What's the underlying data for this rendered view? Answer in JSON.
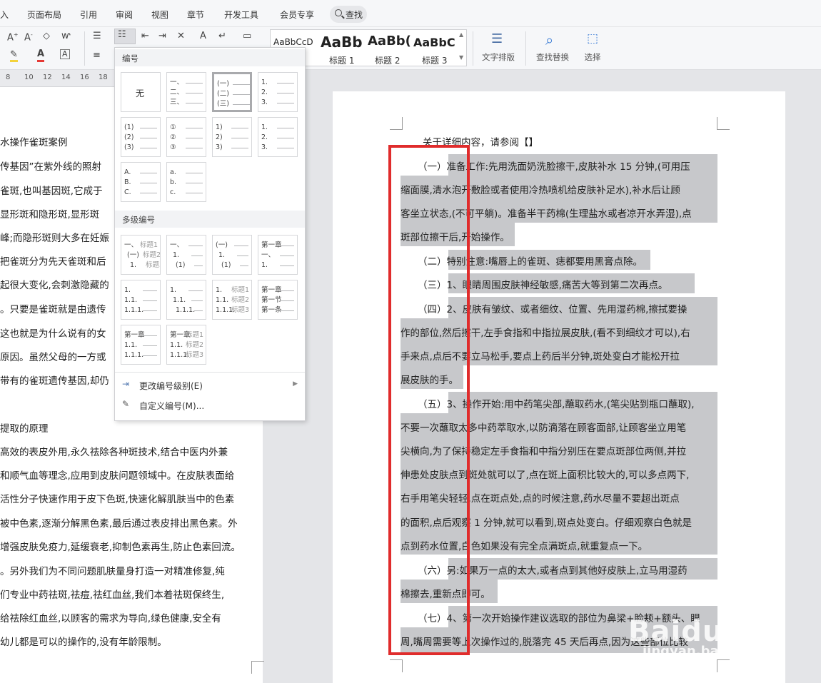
{
  "menu_tabs": [
    "入",
    "页面布局",
    "引用",
    "审阅",
    "视图",
    "章节",
    "开发工具",
    "会员专享"
  ],
  "search_tab": "查找",
  "ribbon": {
    "styles": [
      {
        "preview": "AaBbCcD",
        "name": ""
      },
      {
        "preview": "AaBb",
        "name": "标题 1"
      },
      {
        "preview": "AaBb(",
        "name": "标题 2"
      },
      {
        "preview": "AaBbC",
        "name": "标题 3"
      }
    ],
    "text_layout": "文字排版",
    "find_replace": "查找替换",
    "select": "选择"
  },
  "ruler": [
    "8",
    "10",
    "12",
    "14",
    "16",
    "18"
  ],
  "numbering_panel": {
    "section_numbering": "编号",
    "none_label": "无",
    "single": [
      [
        "一、",
        "二、",
        "三、"
      ],
      [
        "(一)",
        "(二)",
        "(三)"
      ],
      [
        "1.",
        "2.",
        "3."
      ],
      [
        "(1)",
        "(2)",
        "(3)"
      ],
      [
        "①",
        "②",
        "③"
      ],
      [
        "1)",
        "2)",
        "3)"
      ],
      [
        "1.",
        "2.",
        "3."
      ],
      [
        "A.",
        "B.",
        "C."
      ],
      [
        "a.",
        "b.",
        "c."
      ]
    ],
    "section_multilevel": "多级编号",
    "multi": [
      [
        [
          "一、",
          "标题1"
        ],
        [
          "(一)",
          "标题2"
        ],
        [
          "1.",
          "标题3"
        ]
      ],
      [
        [
          "一、",
          ""
        ],
        [
          "1.",
          ""
        ],
        [
          "(1)",
          ""
        ]
      ],
      [
        [
          "(一)",
          ""
        ],
        [
          "1.",
          ""
        ],
        [
          "(1)",
          ""
        ]
      ],
      [
        [
          "第一章",
          ""
        ],
        [
          "一、",
          ""
        ],
        [
          "1.",
          ""
        ]
      ],
      [
        [
          "1.",
          ""
        ],
        [
          "1.1.",
          ""
        ],
        [
          "1.1.1.",
          ""
        ]
      ],
      [
        [
          "1.",
          ""
        ],
        [
          "1.1.",
          ""
        ],
        [
          "1.1.1.",
          ""
        ]
      ],
      [
        [
          "1.",
          "标题1"
        ],
        [
          "1.1.",
          "标题2"
        ],
        [
          "1.1.1.",
          "标题3"
        ]
      ],
      [
        [
          "第一章",
          ""
        ],
        [
          "第一节",
          ""
        ],
        [
          "第一条",
          ""
        ]
      ],
      [
        [
          "第一章",
          ""
        ],
        [
          "1.1.",
          ""
        ],
        [
          "1.1.1.",
          ""
        ]
      ],
      [
        [
          "第一章",
          "标题1"
        ],
        [
          "1.1.",
          "标题2"
        ],
        [
          "1.1.1.",
          "标题3"
        ]
      ]
    ],
    "change_level": "更改编号级别(E)",
    "custom": "自定义编号(M)..."
  },
  "left_lines": [
    "水操作雀斑案例",
    "传基因”在紫外线的照射",
    "雀斑,也叫基因斑,它成于",
    "显形斑和隐形斑,显形斑",
    "峰;而隐形斑则大多在妊娠",
    "把雀斑分为先天雀斑和后",
    "起很大变化,会刺激隐藏的",
    "。只要是雀斑就是由遗传",
    "这也就是为什么说有的女",
    "原因。虽然父母的一方或",
    "带有的雀斑遗传基因,却仍",
    "",
    "提取的原理",
    "高效的表皮外用,永久祛除各种斑技术,结合中医内外兼",
    "和顺气血等理念,应用到皮肤问题领域中。在皮肤表面给",
    "活性分子快速作用于皮下色斑,快速化解肌肤当中的色素",
    "被中色素,逐渐分解黑色素,最后通过表皮排出黑色素。外",
    "增强皮肤免疫力,延缓衰老,抑制色素再生,防止色素回流。",
    "。另外我们为不同问题肌肤量身打造一对精准修复,纯",
    "们专业中药祛斑,祛痘,祛红血丝,我们本着祛斑保终生,",
    "给祛除红血丝,以顾客的需求为导向,绿色健康,安全有",
    "幼儿都是可以的操作的,没有年龄限制。"
  ],
  "right_lines": [
    "关于详细内容，请参阅【】",
    "（一）准备工作:先用洗面奶洗脸擦干,皮肤补水 15 分钟,(可用压",
    "缩面膜,清水泡开敷脸或者使用冷热喷机给皮肤补足水),补水后让顾",
    "客坐立状态,(不可平躺)。准备半干药棉(生理盐水或者凉开水弄湿),点",
    "斑部位擦干后,开始操作。",
    "（二）特别注意:嘴唇上的雀斑、痣都要用黑膏点除。",
    "（三）1、眼睛周围皮肤神经敏感,痛苦大等到第二次再点。",
    "（四）2、皮肤有皱纹、或者细纹、位置、先用湿药棉,擦拭要操",
    "作的部位,然后擦干,左手食指和中指拉展皮肤,(看不到细纹才可以),右",
    "手来点,点后不要立马松手,要点上药后半分钟,斑处变白才能松开拉",
    "展皮肤的手。",
    "（五）3、操作开始:用中药笔尖部,蘸取药水,(笔尖贴到瓶口蘸取),",
    "不要一次蘸取太多中药萃取水,以防滴落在顾客面部,让顾客坐立用笔",
    "尖横向,为了保持稳定左手食指和中指分别压在要点斑部位两侧,并拉",
    "伸患处皮肤点到斑处就可以了,点在斑上面积比较大的,可以多点两下,",
    "右手用笔尖轻轻,点在斑点处,点的时候注意,药水尽量不要超出斑点",
    "的面积,点后观察 1 分钟,就可以看到,斑点处变白。仔细观察白色就是",
    "点到药水位置,白色如果没有完全点满斑点,就重复点一下。",
    "（六）另:如果万一点的太大,或者点到其他好皮肤上,立马用湿药",
    "棉擦去,重新点即可。",
    "（七）4、第一次开始操作建议选取的部位为鼻梁+脸颊+额头、眼",
    "周,嘴周需要等上次操作过的,脱落完 45 天后再点,因为这些部位比较"
  ],
  "watermark": {
    "brand": "Baidu经验",
    "url": "jingyan.baidu.com"
  },
  "colors": {
    "highlight": "#c7c8cb",
    "red_box": "#e02c2c"
  }
}
